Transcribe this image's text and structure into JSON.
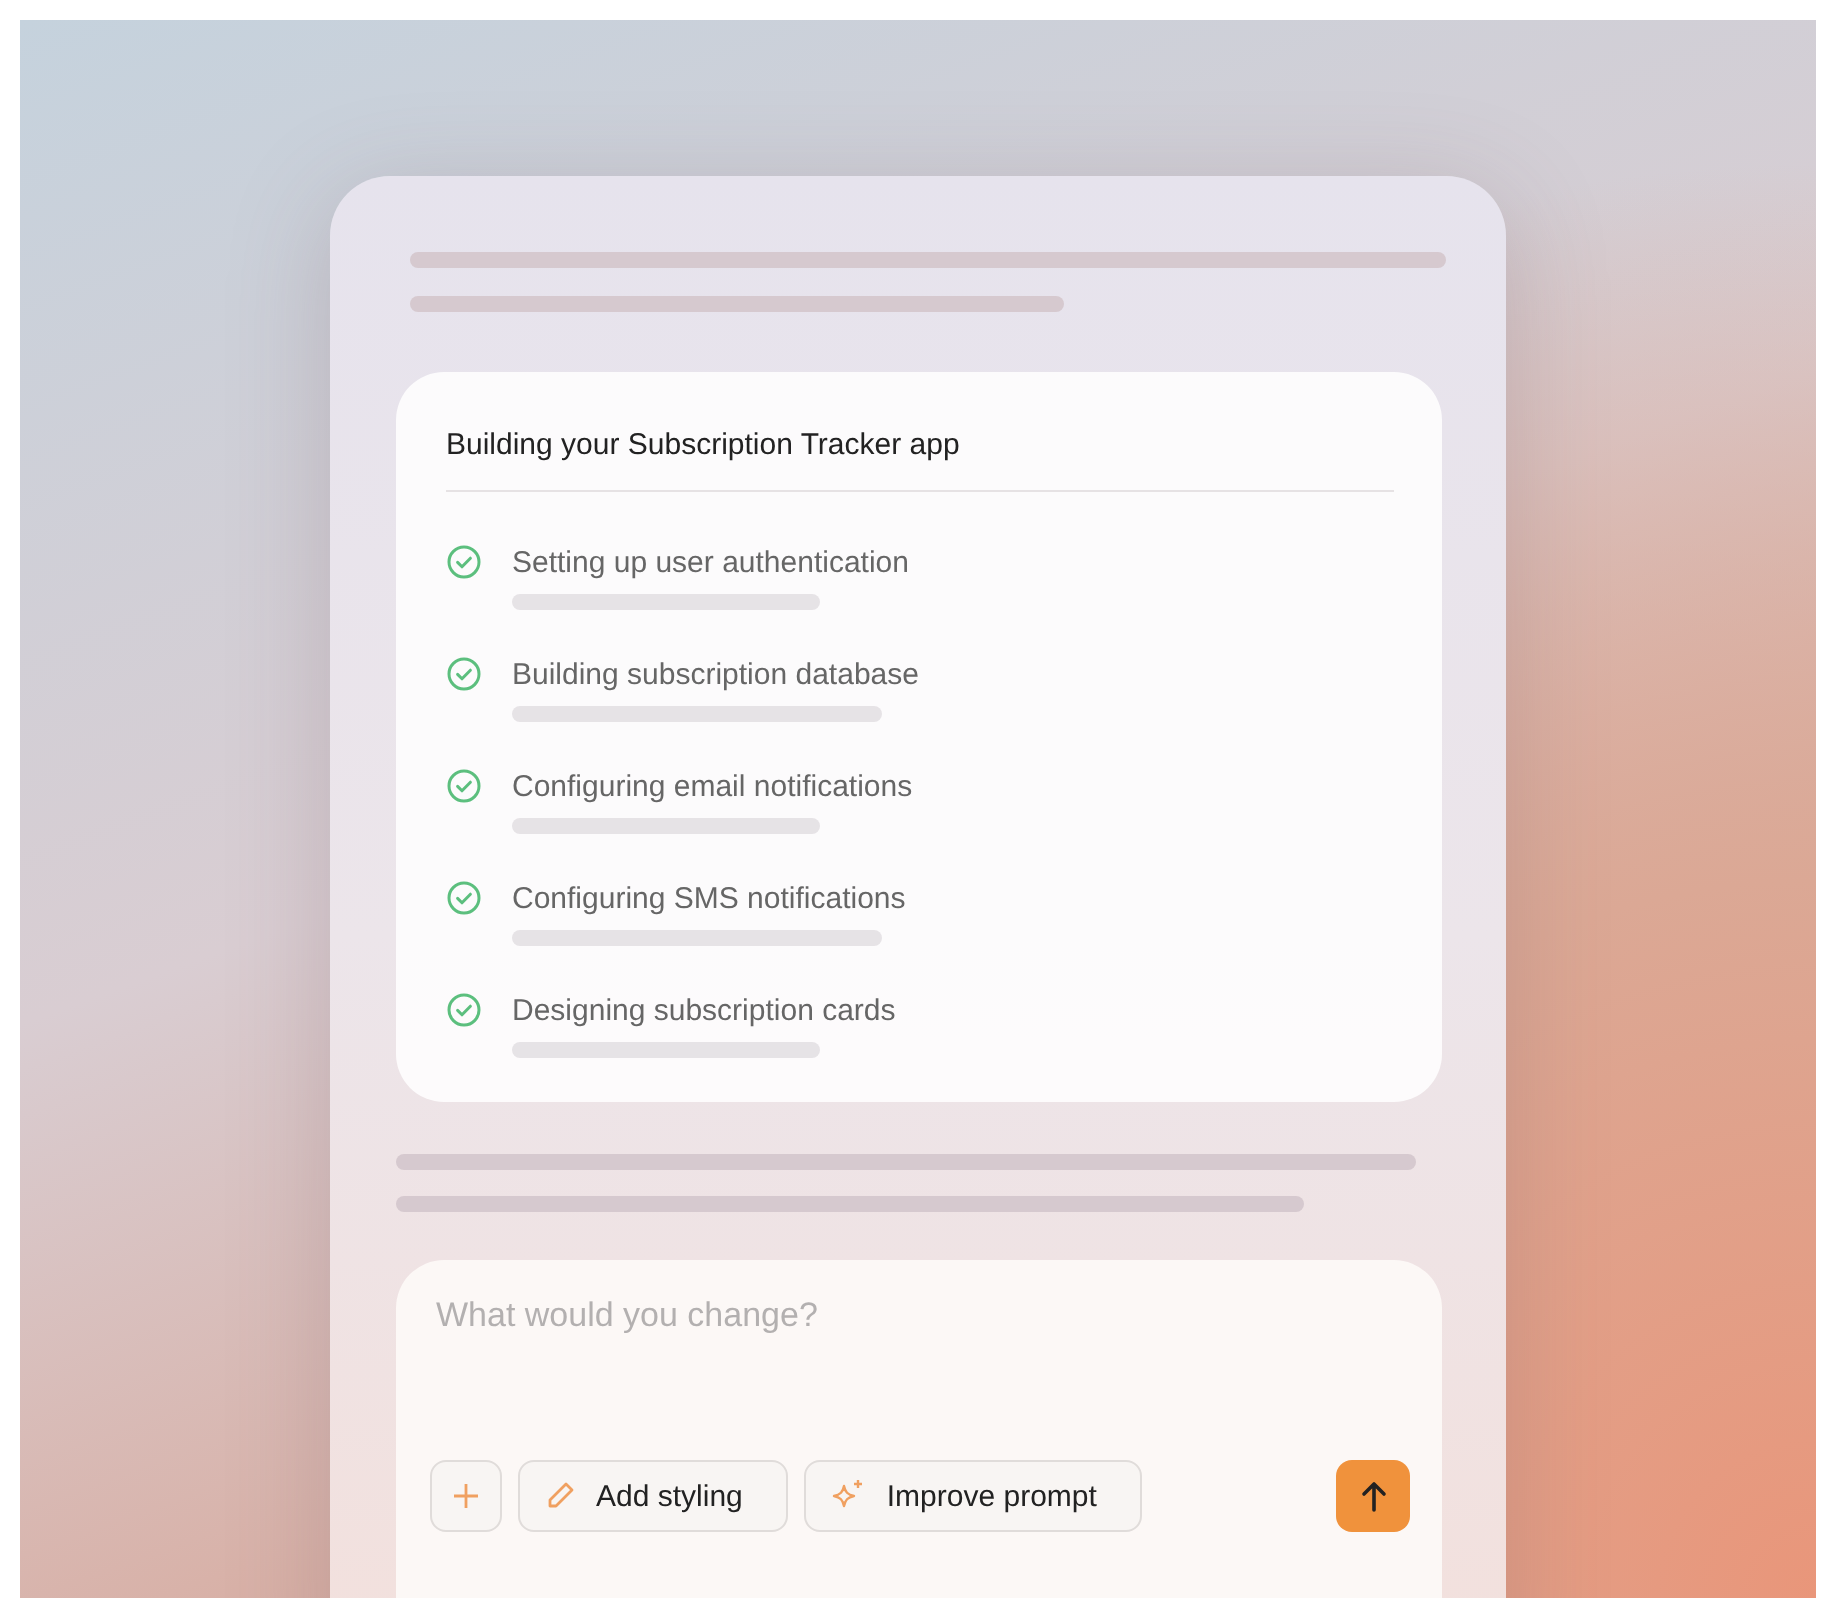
{
  "progress_card": {
    "title": "Building your Subscription Tracker app",
    "steps": [
      {
        "label": "Setting up user authentication",
        "done": true
      },
      {
        "label": "Building subscription database",
        "done": true
      },
      {
        "label": "Configuring email notifications",
        "done": true
      },
      {
        "label": "Configuring SMS notifications",
        "done": true
      },
      {
        "label": "Designing subscription cards",
        "done": true
      }
    ]
  },
  "prompt": {
    "placeholder": "What would you change?",
    "actions": [
      {
        "kind": "add"
      },
      {
        "kind": "styling",
        "label": "Add styling"
      },
      {
        "kind": "improve",
        "label": "Improve prompt"
      }
    ]
  }
}
